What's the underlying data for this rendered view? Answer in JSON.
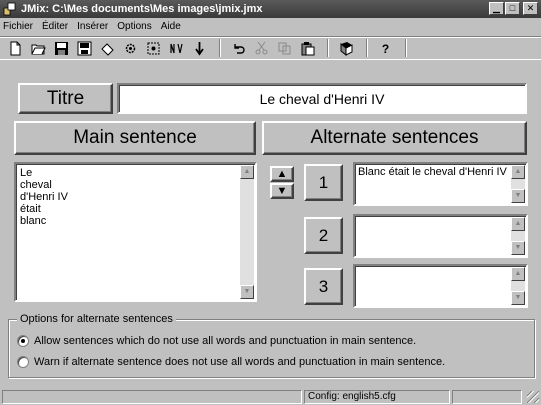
{
  "window": {
    "title": "JMix: C:\\Mes documents\\Mes images\\jmix.jmx",
    "controls": {
      "minimize": "▁",
      "maximize": "□",
      "close": "✕"
    }
  },
  "menu": [
    {
      "label": "Fichier"
    },
    {
      "label": "Éditer"
    },
    {
      "label": "Insérer"
    },
    {
      "label": "Options"
    },
    {
      "label": "Aide"
    }
  ],
  "toolbar": {
    "icons": [
      "new-file-icon",
      "open-folder-icon",
      "save-icon",
      "save-as-icon",
      "eraser-icon",
      "gear-icon",
      "settings-gear-icon",
      "export-icon",
      "download-icon",
      "undo-icon",
      "cut-icon",
      "copy-icon",
      "paste-icon",
      "help-book-icon",
      "help-icon"
    ]
  },
  "titre": {
    "label": "Titre",
    "value": "Le cheval d'Henri IV"
  },
  "main": {
    "label": "Main sentence",
    "words": [
      "Le",
      "cheval",
      "d'Henri IV",
      "était",
      "blanc"
    ]
  },
  "alternates": {
    "label": "Alternate sentences",
    "items": [
      {
        "number": "1",
        "text": "Blanc était le cheval d'Henri IV"
      },
      {
        "number": "2",
        "text": ""
      },
      {
        "number": "3",
        "text": ""
      }
    ]
  },
  "options": {
    "title": "Options for alternate sentences",
    "choices": [
      {
        "label": "Allow sentences which do not use all words and punctuation in main sentence.",
        "selected": true
      },
      {
        "label": "Warn if alternate sentence does not use all words and punctuation in main sentence.",
        "selected": false
      }
    ]
  },
  "status": {
    "left": "",
    "config": "Config: english5.cfg",
    "right": ""
  }
}
